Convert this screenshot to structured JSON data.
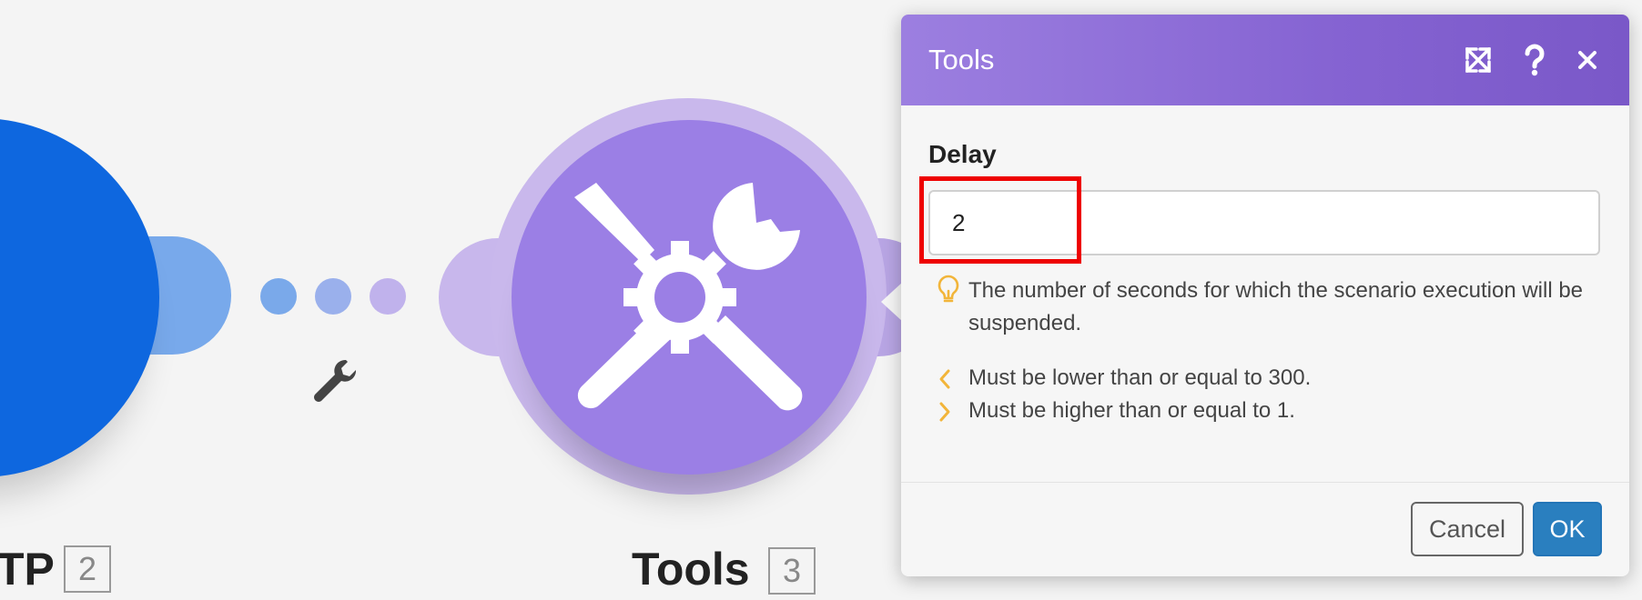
{
  "canvas": {
    "http_node": {
      "label_partial": "TP",
      "badge": "2",
      "icon": "globe-icon",
      "color": "#0e67df"
    },
    "connector": {
      "icon": "wrench-icon",
      "dot_colors": [
        "#7aa9ea",
        "#9ab0ec",
        "#c0b2ec"
      ]
    },
    "tools_node": {
      "label": "Tools",
      "badge": "3",
      "icon": "tools-icon",
      "color": "#9b7fe5"
    }
  },
  "modal": {
    "title": "Tools",
    "header_icons": [
      "expand-icon",
      "help-icon",
      "close-icon"
    ],
    "field": {
      "label": "Delay",
      "value": "2",
      "hint": "The number of seconds for which the scenario execution will be suspended.",
      "rules": [
        {
          "icon": "chevron-left-icon",
          "text": "Must be lower than or equal to 300."
        },
        {
          "icon": "chevron-right-icon",
          "text": "Must be higher than or equal to 1."
        }
      ]
    },
    "buttons": {
      "cancel": "Cancel",
      "ok": "OK"
    }
  },
  "colors": {
    "accent": "#8a6ad6",
    "ok_button": "#2a7fbf",
    "highlight": "#ee0000",
    "hint_icon": "#f2b53a"
  }
}
